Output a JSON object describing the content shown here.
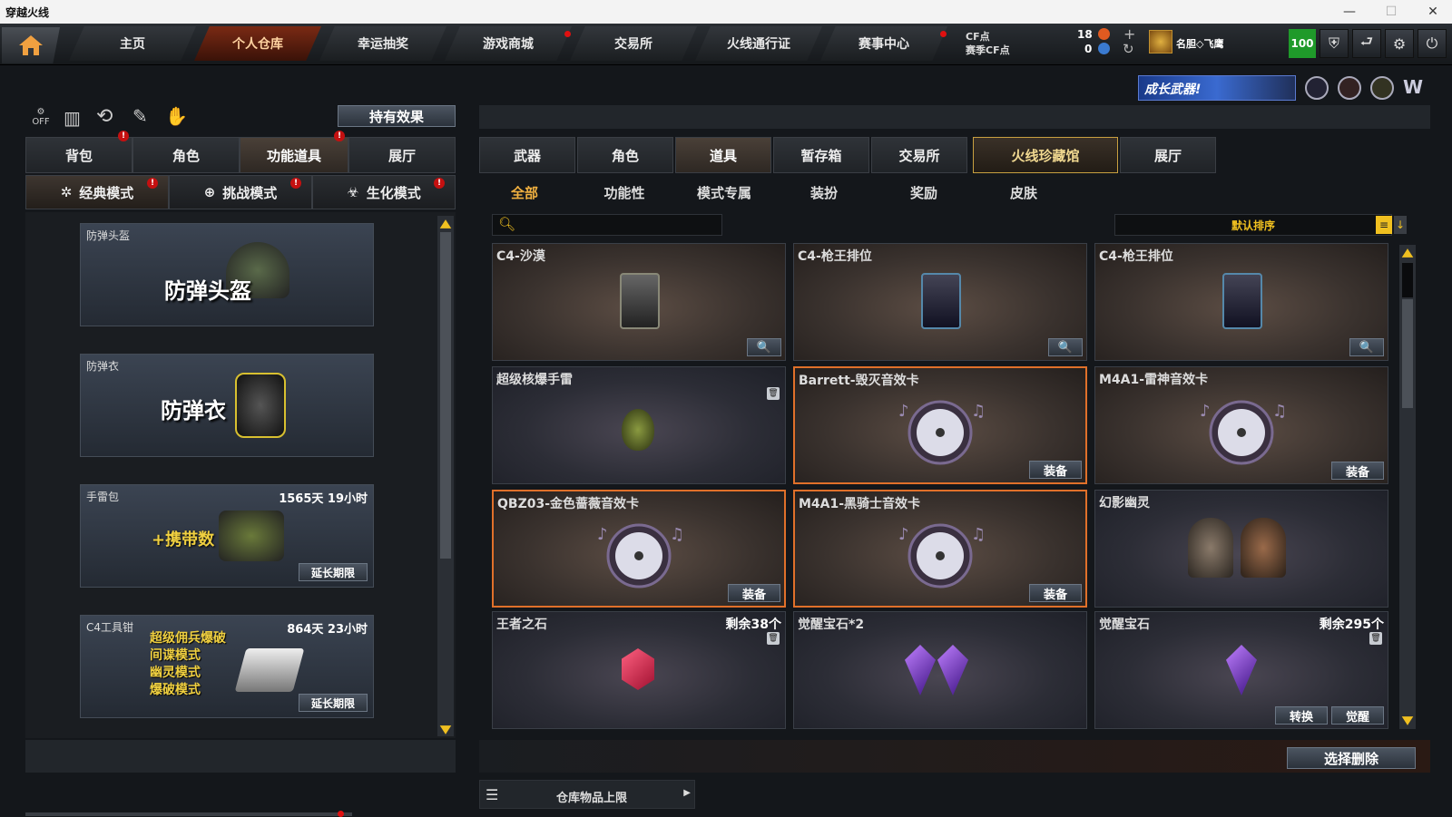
{
  "window": {
    "title": "穿越火线"
  },
  "nav": {
    "tabs": [
      {
        "label": "主页"
      },
      {
        "label": "个人仓库"
      },
      {
        "label": "幸运抽奖"
      },
      {
        "label": "游戏商城"
      },
      {
        "label": "交易所"
      },
      {
        "label": "火线通行证"
      },
      {
        "label": "赛事中心"
      }
    ],
    "cf_label": "CF点",
    "season_cf_label": "赛季CF点",
    "cf_value": "18",
    "season_cf_value": "0",
    "username": "名胆◇飞鹰",
    "hp": "100",
    "banner_text": "成长武器!"
  },
  "left": {
    "effect_button": "持有效果",
    "tabs": [
      {
        "label": "背包"
      },
      {
        "label": "角色"
      },
      {
        "label": "功能道具"
      },
      {
        "label": "展厅"
      }
    ],
    "modes": [
      {
        "label": "经典模式"
      },
      {
        "label": "挑战模式"
      },
      {
        "label": "生化模式"
      }
    ],
    "cards": [
      {
        "name": "防弹头盔",
        "big": "防弹头盔"
      },
      {
        "name": "防弹衣",
        "big": "防弹衣"
      },
      {
        "name": "手雷包",
        "big": "+携带数",
        "time": "1565天 19小时",
        "button": "延长期限"
      },
      {
        "name": "C4工具钳",
        "time": "864天 23小时",
        "button": "延长期限",
        "lines": [
          "超级佣兵爆破",
          "间谍模式",
          "幽灵模式",
          "爆破模式"
        ]
      }
    ]
  },
  "right": {
    "tabs": [
      {
        "label": "武器"
      },
      {
        "label": "角色"
      },
      {
        "label": "道具"
      },
      {
        "label": "暂存箱"
      },
      {
        "label": "交易所"
      },
      {
        "label": "火线珍藏馆"
      },
      {
        "label": "展厅"
      }
    ],
    "subtabs": [
      {
        "label": "全部"
      },
      {
        "label": "功能性"
      },
      {
        "label": "模式专属"
      },
      {
        "label": "装扮"
      },
      {
        "label": "奖励"
      },
      {
        "label": "皮肤"
      }
    ],
    "sort_label": "默认排序",
    "items": [
      {
        "name": "C4-沙漠",
        "button": "🔍"
      },
      {
        "name": "C4-枪王排位",
        "button": "🔍"
      },
      {
        "name": "C4-枪王排位",
        "button": "🔍"
      },
      {
        "name": "超级核爆手雷"
      },
      {
        "name": "Barrett-毁灭音效卡",
        "button": "装备"
      },
      {
        "name": "M4A1-雷神音效卡",
        "button": "装备"
      },
      {
        "name": "QBZ03-金色蔷薇音效卡",
        "button": "装备"
      },
      {
        "name": "M4A1-黑骑士音效卡",
        "button": "装备"
      },
      {
        "name": "幻影幽灵"
      },
      {
        "name": "王者之石",
        "remaining": "剩余38个"
      },
      {
        "name": "觉醒宝石*2"
      },
      {
        "name": "觉醒宝石",
        "remaining": "剩余295个",
        "button": "转换",
        "button2": "觉醒"
      }
    ],
    "delete_button": "选择删除",
    "storage_label": "仓库物品上限"
  }
}
